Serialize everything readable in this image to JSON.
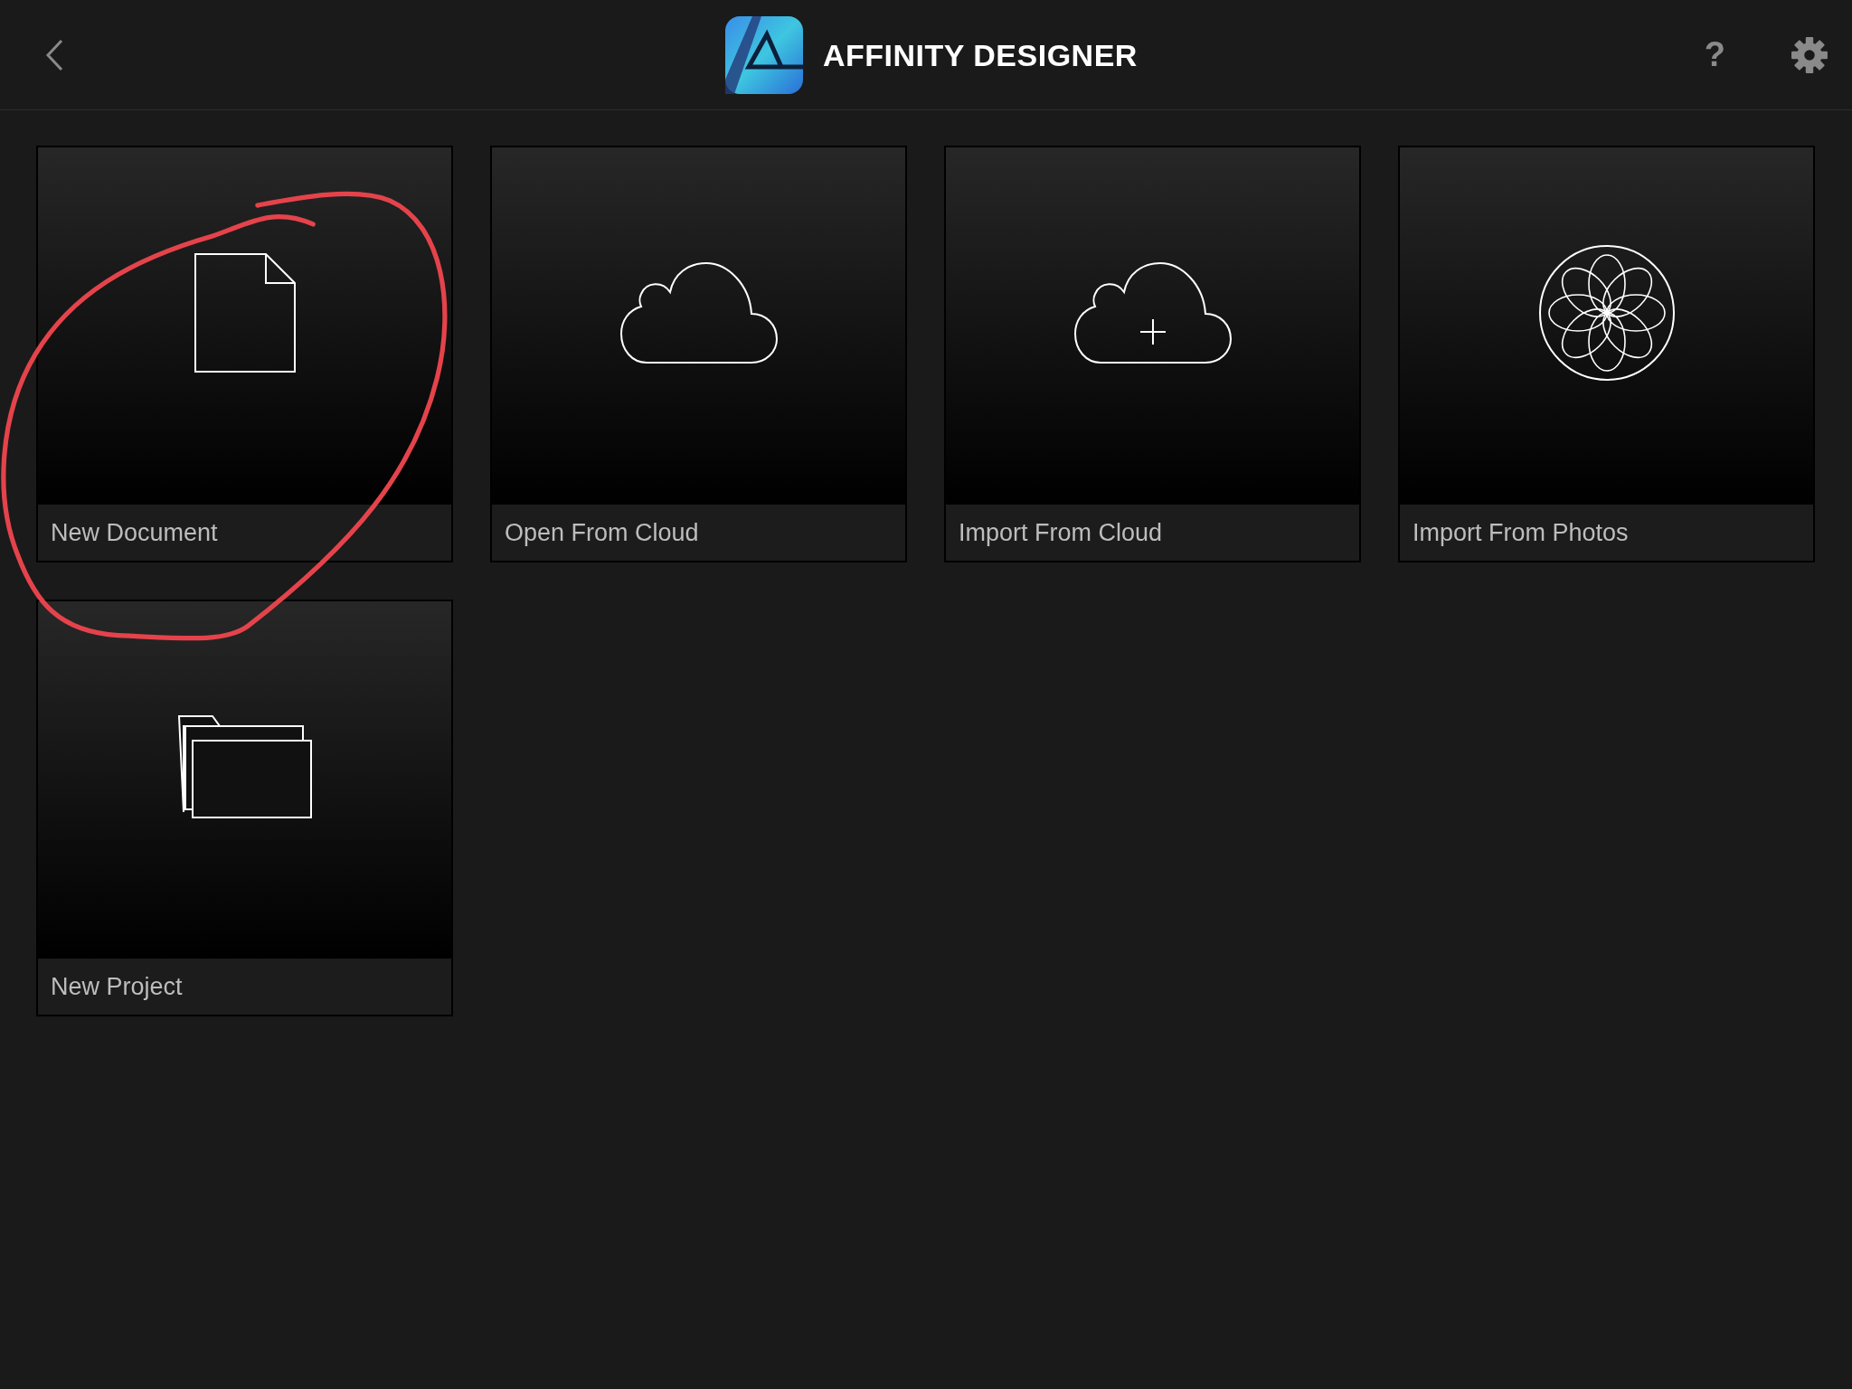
{
  "header": {
    "title": "AFFINITY DESIGNER",
    "help": "?"
  },
  "tiles": [
    {
      "kind": "document",
      "label": "New Document"
    },
    {
      "kind": "cloud",
      "label": "Open From Cloud"
    },
    {
      "kind": "cloud-plus",
      "label": "Import From Cloud"
    },
    {
      "kind": "flower",
      "label": "Import From Photos"
    },
    {
      "kind": "folders",
      "label": "New Project"
    }
  ]
}
